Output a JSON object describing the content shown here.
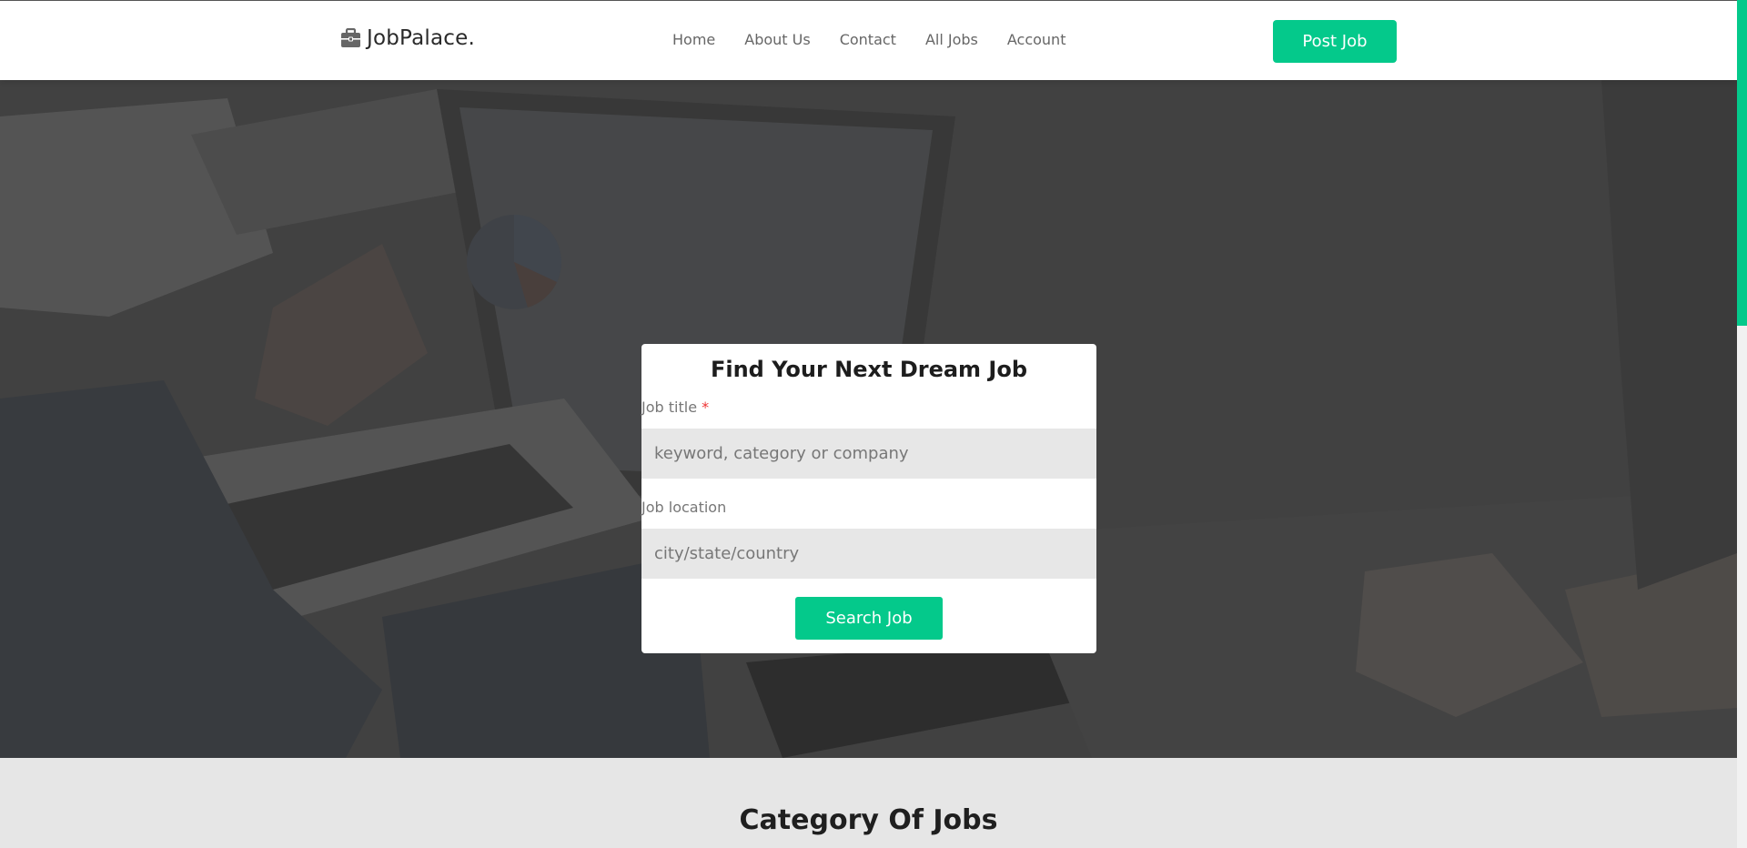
{
  "brand": {
    "name": "JobPalace.",
    "icon": "briefcase-icon"
  },
  "nav": {
    "items": [
      {
        "label": "Home"
      },
      {
        "label": "About Us"
      },
      {
        "label": "Contact"
      },
      {
        "label": "All Jobs"
      },
      {
        "label": "Account"
      }
    ],
    "cta_label": "Post Job"
  },
  "search": {
    "title": "Find Your Next Dream Job",
    "job_title_label": "Job title",
    "required_mark": "*",
    "job_title_placeholder": "keyword, category or company",
    "job_title_value": "",
    "job_location_label": "Job location",
    "job_location_placeholder": "city/state/country",
    "job_location_value": "",
    "submit_label": "Search Job"
  },
  "categories": {
    "title": "Category Of Jobs"
  },
  "colors": {
    "accent": "#04c98b",
    "required": "#ee3333",
    "header_bg": "#ffffff",
    "section_bg": "#e6e6e6"
  }
}
